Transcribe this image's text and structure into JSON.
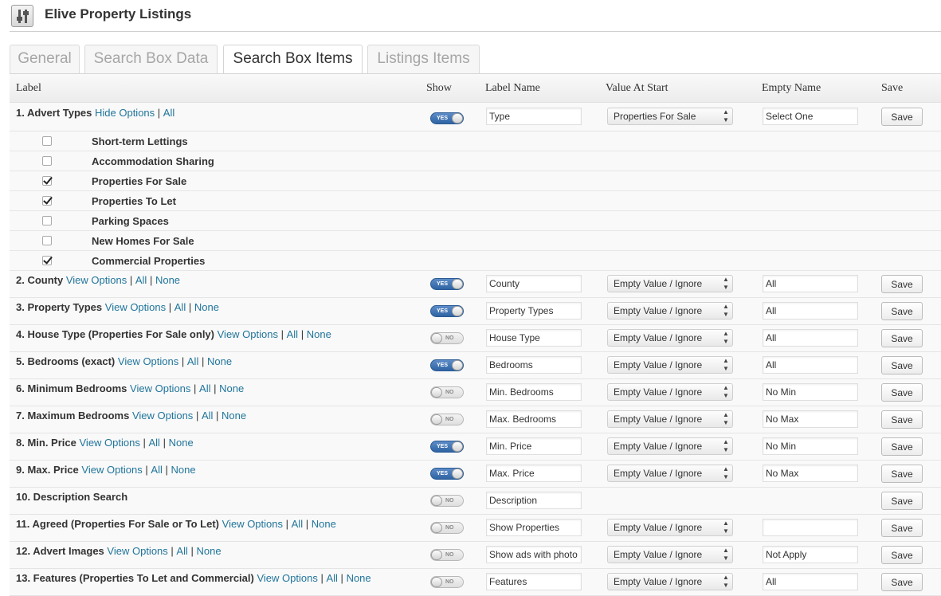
{
  "app": {
    "title": "Elive Property Listings"
  },
  "tabs": [
    {
      "label": "General"
    },
    {
      "label": "Search Box Data"
    },
    {
      "label": "Search Box Items"
    },
    {
      "label": "Listings Items"
    }
  ],
  "active_tab": "Search Box Items",
  "table": {
    "headers": {
      "label": "Label",
      "show": "Show",
      "label_name": "Label Name",
      "value_at_start": "Value At Start",
      "empty_name": "Empty Name",
      "save": "Save"
    },
    "toggle_yes": "YES",
    "toggle_no": "NO",
    "save_label": "Save",
    "sep": "|",
    "rows": [
      {
        "label": "1. Advert Types",
        "links": [
          "Hide Options",
          "All"
        ],
        "show": true,
        "label_name": "Type",
        "value_at_start": "Properties For Sale",
        "empty_name": "Select One",
        "options": [
          {
            "label": "Short-term Lettings",
            "checked": false
          },
          {
            "label": "Accommodation Sharing",
            "checked": false
          },
          {
            "label": "Properties For Sale",
            "checked": true
          },
          {
            "label": "Properties To Let",
            "checked": true
          },
          {
            "label": "Parking Spaces",
            "checked": false
          },
          {
            "label": "New Homes For Sale",
            "checked": false
          },
          {
            "label": "Commercial Properties",
            "checked": true
          }
        ]
      },
      {
        "label": "2. County",
        "links": [
          "View Options",
          "All",
          "None"
        ],
        "show": true,
        "label_name": "County",
        "value_at_start": "Empty Value / Ignore",
        "empty_name": "All"
      },
      {
        "label": "3. Property Types",
        "links": [
          "View Options",
          "All",
          "None"
        ],
        "show": true,
        "label_name": "Property Types",
        "value_at_start": "Empty Value / Ignore",
        "empty_name": "All"
      },
      {
        "label": "4. House Type (Properties For Sale only)",
        "links": [
          "View Options",
          "All",
          "None"
        ],
        "show": false,
        "label_name": "House Type",
        "value_at_start": "Empty Value / Ignore",
        "empty_name": "All"
      },
      {
        "label": "5. Bedrooms (exact)",
        "links": [
          "View Options",
          "All",
          "None"
        ],
        "show": true,
        "label_name": "Bedrooms",
        "value_at_start": "Empty Value / Ignore",
        "empty_name": "All"
      },
      {
        "label": "6. Minimum Bedrooms",
        "links": [
          "View Options",
          "All",
          "None"
        ],
        "show": false,
        "label_name": "Min. Bedrooms",
        "value_at_start": "Empty Value / Ignore",
        "empty_name": "No Min"
      },
      {
        "label": "7. Maximum Bedrooms",
        "links": [
          "View Options",
          "All",
          "None"
        ],
        "show": false,
        "label_name": "Max. Bedrooms",
        "value_at_start": "Empty Value / Ignore",
        "empty_name": "No Max"
      },
      {
        "label": "8. Min. Price",
        "links": [
          "View Options",
          "All",
          "None"
        ],
        "show": true,
        "label_name": "Min. Price",
        "value_at_start": "Empty Value / Ignore",
        "empty_name": "No Min"
      },
      {
        "label": "9. Max. Price",
        "links": [
          "View Options",
          "All",
          "None"
        ],
        "show": true,
        "label_name": "Max. Price",
        "value_at_start": "Empty Value / Ignore",
        "empty_name": "No Max"
      },
      {
        "label": "10. Description Search",
        "links": [],
        "show": false,
        "label_name": "Description",
        "value_at_start": null,
        "empty_name": null
      },
      {
        "label": "11. Agreed (Properties For Sale or To Let)",
        "links": [
          "View Options",
          "All",
          "None"
        ],
        "show": false,
        "label_name": "Show Properties",
        "value_at_start": "Empty Value / Ignore",
        "empty_name": ""
      },
      {
        "label": "12. Advert Images",
        "links": [
          "View Options",
          "All",
          "None"
        ],
        "show": false,
        "label_name": "Show ads with photo",
        "value_at_start": "Empty Value / Ignore",
        "empty_name": "Not Apply"
      },
      {
        "label": "13. Features (Properties To Let and Commercial)",
        "links": [
          "View Options",
          "All",
          "None"
        ],
        "show": false,
        "label_name": "Features",
        "value_at_start": "Empty Value / Ignore",
        "empty_name": "All"
      }
    ]
  },
  "colors": {
    "link": "#21759b",
    "toggle_on": "#2e63a3"
  }
}
